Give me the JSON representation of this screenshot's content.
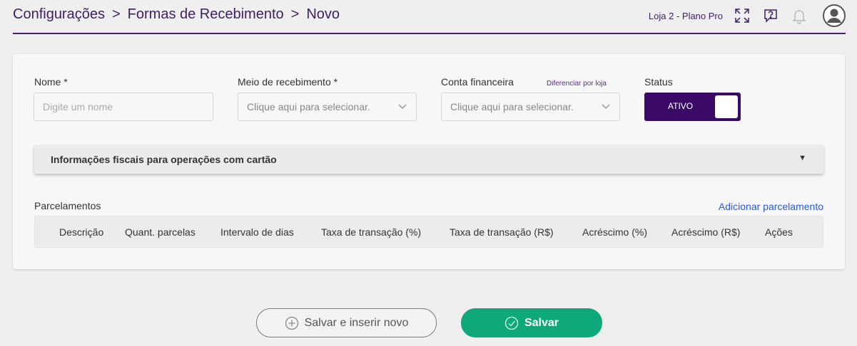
{
  "breadcrumb": {
    "items": [
      "Configurações",
      "Formas de Recebimento",
      "Novo"
    ],
    "separator": ">"
  },
  "header": {
    "store": "Loja 2 - Plano Pro",
    "icons": [
      "expand-icon",
      "help-icon",
      "bell-icon",
      "user-avatar-icon"
    ]
  },
  "form": {
    "name": {
      "label": "Nome *",
      "placeholder": "Digite um nome"
    },
    "payment_method": {
      "label": "Meio de recebimento *",
      "placeholder": "Clique aqui para selecionar."
    },
    "account": {
      "label": "Conta financeira",
      "link": "Diferenciar por loja",
      "placeholder": "Clique aqui para selecionar."
    },
    "status": {
      "label": "Status",
      "value": "ATIVO"
    }
  },
  "accordion": {
    "title": "Informações fiscais para operações com cartão"
  },
  "installments": {
    "title": "Parcelamentos",
    "add_link": "Adicionar parcelamento",
    "columns": [
      "Descrição",
      "Quant. parcelas",
      "Intervalo de dias",
      "Taxa de transação (%)",
      "Taxa de transação (R$)",
      "Acréscimo (%)",
      "Acréscimo (R$)",
      "Ações"
    ]
  },
  "actions": {
    "save_and_new": "Salvar e inserir novo",
    "save": "Salvar"
  },
  "colors": {
    "brand": "#3a0a66",
    "primary_button": "#0fa87a",
    "link": "#2a5bd7"
  }
}
